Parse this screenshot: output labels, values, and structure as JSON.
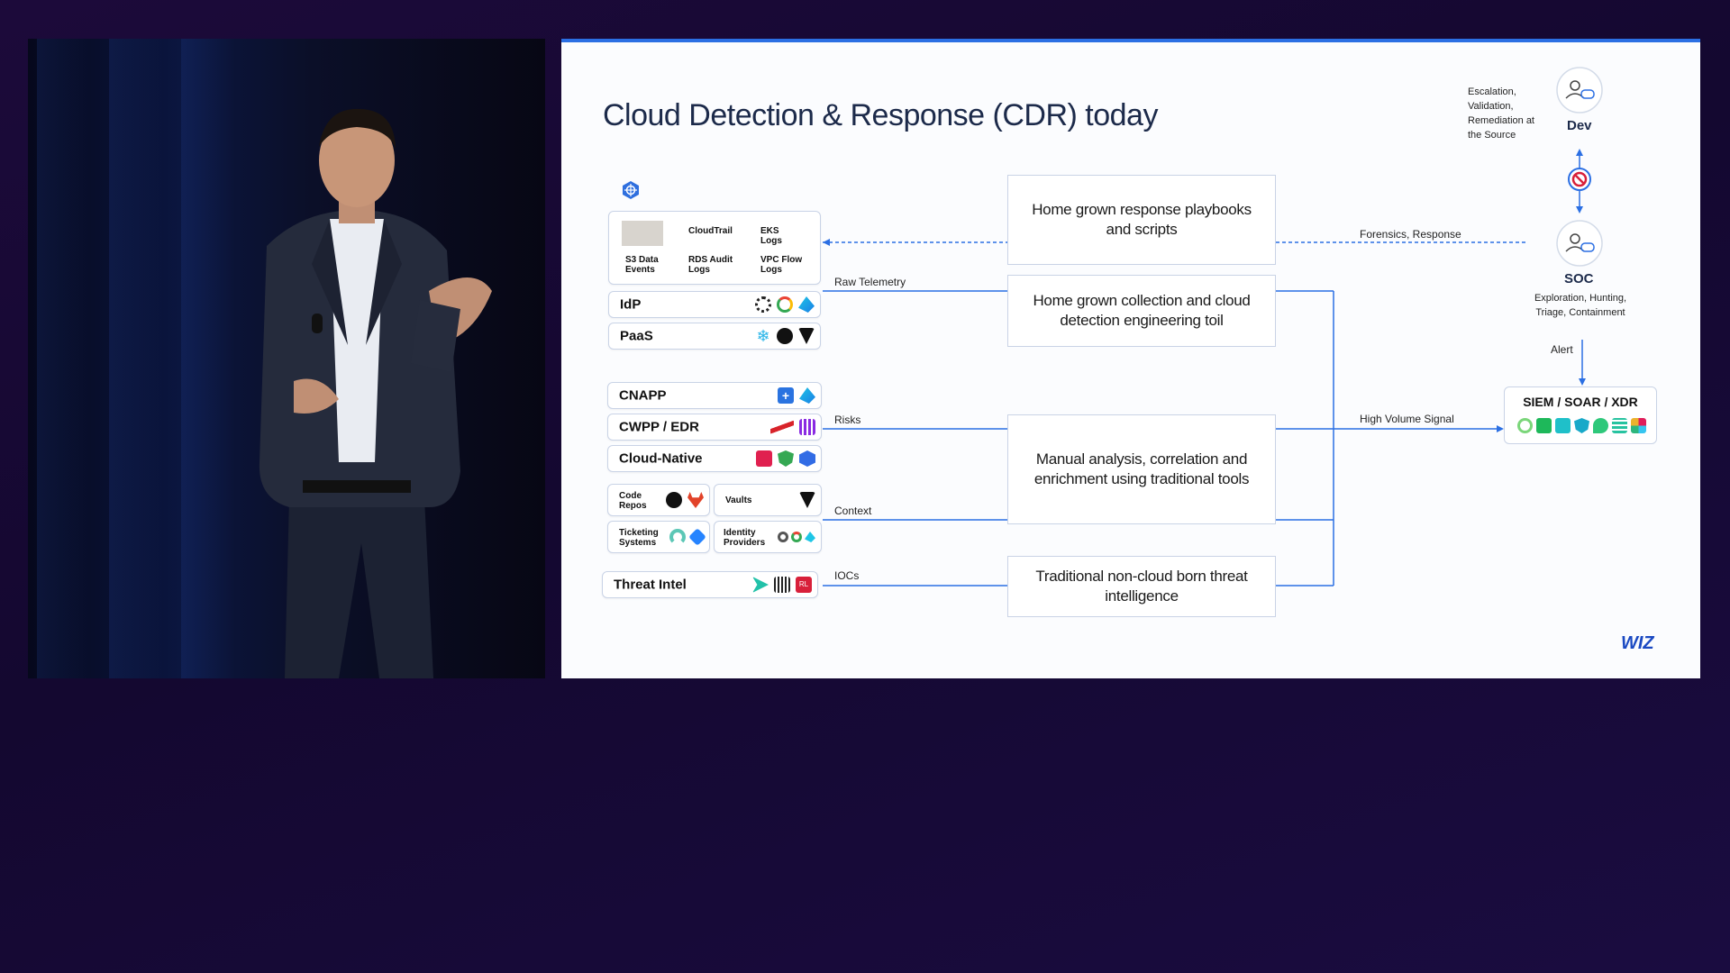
{
  "slide": {
    "title": "Cloud Detection & Response (CDR) today",
    "logo_text": "WIZ",
    "aws_logs": [
      "CloudTrail",
      "EKS Logs",
      "S3 Data Events",
      "RDS Audit Logs",
      "VPC Flow Logs"
    ],
    "sources": [
      {
        "label": "IdP",
        "icons": [
          "okta-icon",
          "google-icon",
          "azure-icon"
        ]
      },
      {
        "label": "PaaS",
        "icons": [
          "snowflake-icon",
          "github-icon",
          "vercel-icon"
        ]
      },
      {
        "label": "CNAPP",
        "icons": [
          "plus-icon",
          "azure-icon"
        ]
      },
      {
        "label": "CWPP / EDR",
        "icons": [
          "crowdstrike-icon",
          "sentinelone-icon"
        ]
      },
      {
        "label": "Cloud-Native",
        "icons": [
          "aws-security-icon",
          "gcp-security-icon",
          "kubernetes-icon"
        ]
      },
      {
        "label": "Code Repos",
        "icons": [
          "github-icon",
          "gitlab-icon"
        ]
      },
      {
        "label": "Vaults",
        "icons": [
          "vault-icon"
        ]
      },
      {
        "label": "Ticketing Systems",
        "icons": [
          "servicenow-icon",
          "jira-icon"
        ]
      },
      {
        "label": "Identity Providers",
        "icons": [
          "okta-icon",
          "google-icon",
          "azure-icon"
        ]
      },
      {
        "label": "Threat Intel",
        "icons": [
          "arrow-icon",
          "recorded-icon",
          "rl-icon"
        ]
      }
    ],
    "rl_text": "RL",
    "flow_labels": {
      "raw_telemetry": "Raw Telemetry",
      "risks": "Risks",
      "context": "Context",
      "iocs": "IOCs",
      "forensics": "Forensics, Response",
      "high_volume": "High Volume Signal",
      "alert": "Alert"
    },
    "process_boxes": [
      "Home grown response playbooks and scripts",
      "Home grown collection and cloud detection engineering toil",
      "Manual analysis, correlation and enrichment using traditional tools",
      "Traditional non-cloud born threat intelligence"
    ],
    "dev": {
      "title": "Dev",
      "note": "Escalation, Validation, Remediation at the Source"
    },
    "soc": {
      "title": "SOC",
      "note": "Exploration, Hunting, Triage, Containment"
    },
    "siem": {
      "title": "SIEM / SOAR / XDR",
      "icons": [
        "sumo-icon",
        "terminal-icon",
        "plus-icon",
        "shield-icon",
        "elastic-icon",
        "stack-icon",
        "slack-icon"
      ]
    }
  }
}
